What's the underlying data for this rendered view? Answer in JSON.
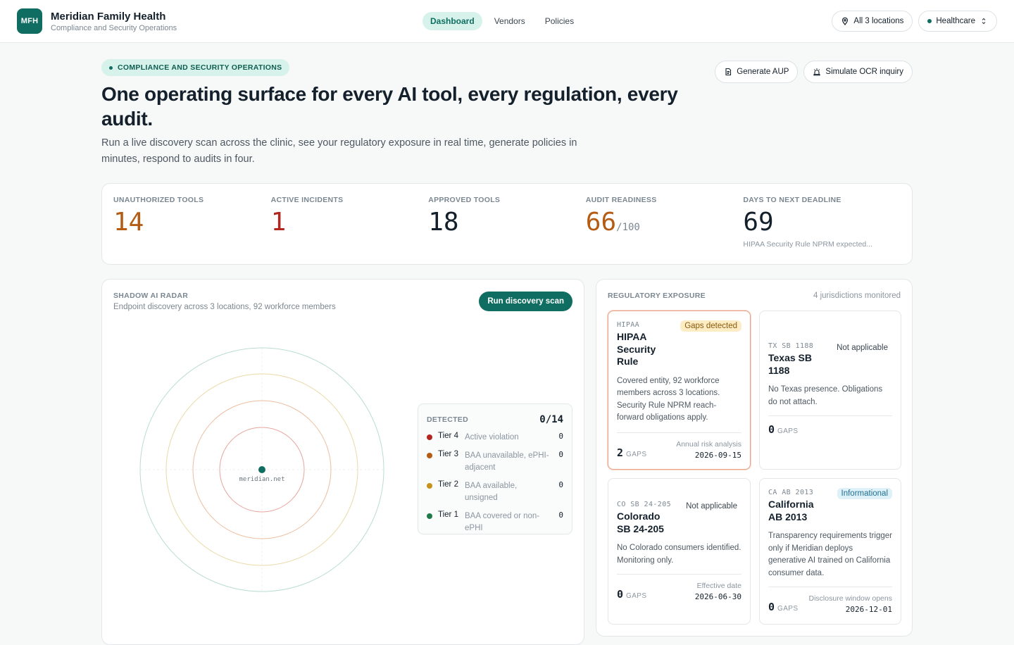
{
  "brand": {
    "initials": "MFH",
    "name": "Meridian Family Health",
    "subtitle": "Compliance and Security Operations"
  },
  "nav": [
    {
      "label": "Dashboard",
      "active": true
    },
    {
      "label": "Vendors",
      "active": false
    },
    {
      "label": "Policies",
      "active": false
    }
  ],
  "top_right": {
    "locations_label": "All 3 locations",
    "locations_icon": "map-pin-icon",
    "industry_label": "Healthcare",
    "industry_icon": "chevron-updown-icon"
  },
  "hero": {
    "eyebrow": "COMPLIANCE AND SECURITY OPERATIONS",
    "headline": "One operating surface for every AI tool, every regulation, every audit.",
    "intro": "Run a live discovery scan across the clinic, see your regulatory exposure in real time, generate policies in minutes, respond to audits in four.",
    "actions": [
      {
        "label": "Generate AUP",
        "icon": "document-icon"
      },
      {
        "label": "Simulate OCR inquiry",
        "icon": "siren-icon"
      }
    ]
  },
  "metrics": [
    {
      "label": "UNAUTHORIZED TOOLS",
      "value": "14",
      "unit": "",
      "note": "",
      "color": "#b45c14"
    },
    {
      "label": "ACTIVE INCIDENTS",
      "value": "1",
      "unit": "",
      "note": "",
      "color": "#b3261e"
    },
    {
      "label": "APPROVED TOOLS",
      "value": "18",
      "unit": "",
      "note": "",
      "color": "#14202b"
    },
    {
      "label": "AUDIT READINESS",
      "value": "66",
      "unit": "/100",
      "note": "",
      "color": "#b45c14"
    },
    {
      "label": "DAYS TO NEXT DEADLINE",
      "value": "69",
      "unit": "",
      "note": "HIPAA Security Rule NPRM expected...",
      "color": "#14202b"
    }
  ],
  "radar": {
    "title": "SHADOW AI RADAR",
    "subtitle": "Endpoint discovery across 3 locations, 92 workforce members",
    "scan_button": "Run discovery scan",
    "center_label": "meridian.net",
    "ring_colors": [
      "#e7a49c",
      "#ecbe9f",
      "#ead8a6",
      "#b9dcd4"
    ],
    "detected": {
      "title": "DETECTED",
      "count": "0/14",
      "tiers": [
        {
          "name": "Tier 4",
          "desc": "Active violation",
          "count": "0",
          "color": "#b3261e"
        },
        {
          "name": "Tier 3",
          "desc": "BAA unavailable, ePHI-adjacent",
          "count": "0",
          "color": "#b45c14"
        },
        {
          "name": "Tier 2",
          "desc": "BAA available, unsigned",
          "count": "0",
          "color": "#c7921c"
        },
        {
          "name": "Tier 1",
          "desc": "BAA covered or non-ePHI",
          "count": "0",
          "color": "#1f7a48"
        }
      ]
    }
  },
  "regulatory": {
    "title": "REGULATORY EXPOSURE",
    "monitored": "4 jurisdictions monitored",
    "gaps_label": "GAPS",
    "cards": [
      {
        "code": "HIPAA",
        "name": "HIPAA Security Rule",
        "badge": "Gaps detected",
        "badge_kind": "warn",
        "desc": "Covered entity, 92 workforce members across 3 locations. Security Rule NPRM reach-forward obligations apply.",
        "gaps": "2",
        "foot_label": "Annual risk analysis",
        "foot_date": "2026-09-15"
      },
      {
        "code": "TX SB 1188",
        "name": "Texas SB 1188",
        "badge": "Not applicable",
        "badge_kind": "na",
        "desc": "No Texas presence. Obligations do not attach.",
        "gaps": "0",
        "foot_label": "",
        "foot_date": ""
      },
      {
        "code": "CO SB 24-205",
        "name": "Colorado SB 24-205",
        "badge": "Not applicable",
        "badge_kind": "na",
        "desc": "No Colorado consumers identified. Monitoring only.",
        "gaps": "0",
        "foot_label": "Effective date",
        "foot_date": "2026-06-30"
      },
      {
        "code": "CA AB 2013",
        "name": "California AB 2013",
        "badge": "Informational",
        "badge_kind": "info",
        "desc": "Transparency requirements trigger only if Meridian deploys generative AI trained on California consumer data.",
        "gaps": "0",
        "foot_label": "Disclosure window opens",
        "foot_date": "2026-12-01"
      }
    ]
  }
}
